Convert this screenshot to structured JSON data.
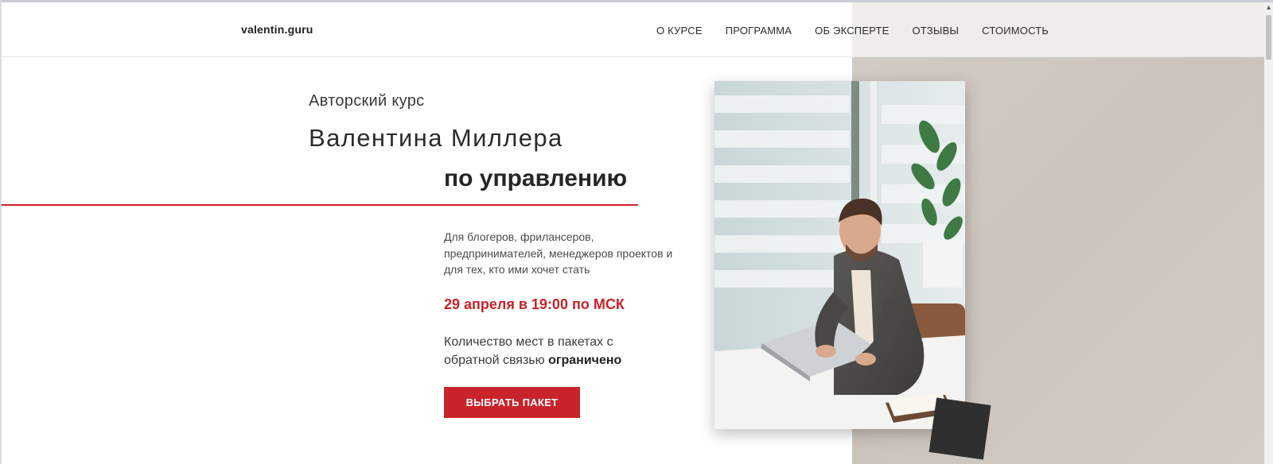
{
  "header": {
    "logo": "valentin.guru",
    "nav": [
      "О КУРСЕ",
      "ПРОГРАММА",
      "ОБ ЭКСПЕРТЕ",
      "ОТЗЫВЫ",
      "СТОИМОСТЬ"
    ]
  },
  "hero": {
    "kicker": "Авторский курс",
    "author": "Валентина Миллера",
    "headline": "по управлению",
    "audience": "Для блогеров, фрилансеров, предпринимателей, менеджеров проектов и для тех, кто ими хочет стать",
    "date": "29 апреля в 19:00 по МСК",
    "seats_text": "Количество мест в пакетах с обратной связью",
    "seats_bold": "ограничено",
    "cta": "ВЫБРАТЬ ПАКЕТ"
  },
  "colors": {
    "accent": "#c9232b",
    "panel": "#cfc8c1",
    "text": "#2b2b2b"
  },
  "icons": {
    "scroll_up": "chevron-up-icon"
  }
}
